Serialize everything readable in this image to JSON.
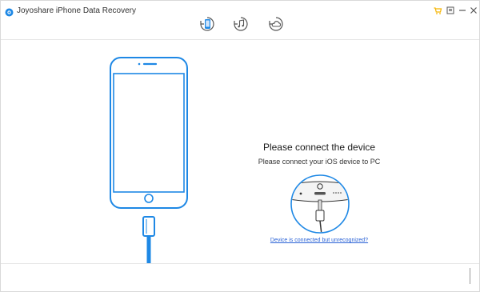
{
  "app": {
    "title": "Joyoshare iPhone Data Recovery",
    "logo": "joyoshare-logo-icon"
  },
  "modes": [
    {
      "name": "recover-from-ios-device",
      "icon": "phone-recover-icon",
      "active": true
    },
    {
      "name": "recover-from-itunes",
      "icon": "itunes-music-icon",
      "active": false
    },
    {
      "name": "recover-from-icloud",
      "icon": "icloud-icon",
      "active": false
    }
  ],
  "window_controls": [
    {
      "name": "upgrade",
      "icon": "cart-icon"
    },
    {
      "name": "menu",
      "icon": "menu-icon"
    },
    {
      "name": "minimize",
      "icon": "minimize-icon"
    },
    {
      "name": "close",
      "icon": "close-icon"
    }
  ],
  "main": {
    "heading": "Please connect the device",
    "subheading": "Please connect your iOS device to PC",
    "help_link": "Device is connected but unrecognized?"
  },
  "colors": {
    "accent": "#2a62d6",
    "phone_blue": "#1e88e5",
    "gold": "#f5b400"
  }
}
